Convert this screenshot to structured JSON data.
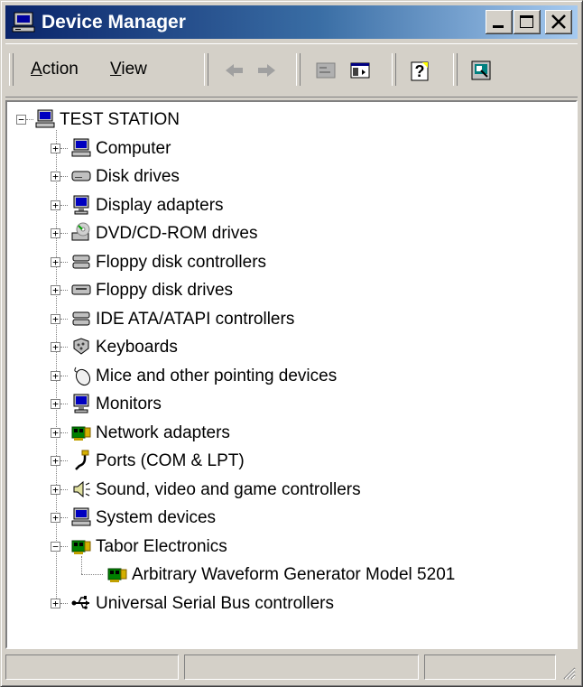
{
  "window": {
    "title": "Device Manager",
    "minimize_label": "_",
    "maximize_label": "□",
    "close_label": "×"
  },
  "toolbar": {
    "action": {
      "accel": "A",
      "rest": "ction"
    },
    "view": {
      "accel": "V",
      "rest": "iew"
    },
    "buttons": [
      "back-arrow-icon",
      "forward-arrow-icon",
      "properties-icon",
      "show-hide-console-tree-icon",
      "help-icon",
      "scan-hardware-icon"
    ]
  },
  "tree": {
    "root": "TEST STATION",
    "items": [
      {
        "label": "Computer",
        "icon": "computer-icon",
        "expanded": false
      },
      {
        "label": "Disk drives",
        "icon": "disk-drive-icon",
        "expanded": false
      },
      {
        "label": "Display adapters",
        "icon": "display-adapter-icon",
        "expanded": false
      },
      {
        "label": "DVD/CD-ROM drives",
        "icon": "cdrom-icon",
        "expanded": false
      },
      {
        "label": "Floppy disk controllers",
        "icon": "controller-icon",
        "expanded": false
      },
      {
        "label": "Floppy disk drives",
        "icon": "floppy-drive-icon",
        "expanded": false
      },
      {
        "label": "IDE ATA/ATAPI controllers",
        "icon": "controller-icon",
        "expanded": false
      },
      {
        "label": "Keyboards",
        "icon": "keyboard-icon",
        "expanded": false
      },
      {
        "label": "Mice and other pointing devices",
        "icon": "mouse-icon",
        "expanded": false
      },
      {
        "label": "Monitors",
        "icon": "monitor-icon",
        "expanded": false
      },
      {
        "label": "Network adapters",
        "icon": "network-card-icon",
        "expanded": false
      },
      {
        "label": "Ports (COM & LPT)",
        "icon": "port-icon",
        "expanded": false
      },
      {
        "label": "Sound, video and game controllers",
        "icon": "speaker-icon",
        "expanded": false
      },
      {
        "label": "System devices",
        "icon": "computer-icon",
        "expanded": false
      },
      {
        "label": "Tabor Electronics",
        "icon": "network-card-icon",
        "expanded": true
      },
      {
        "label": "Universal Serial Bus controllers",
        "icon": "usb-icon",
        "expanded": false
      }
    ],
    "child": {
      "parent": "Tabor Electronics",
      "label": "Arbitrary Waveform Generator Model 5201",
      "icon": "network-card-icon"
    }
  },
  "colors": {
    "face": "#d4d0c8",
    "title_start": "#0a246a",
    "title_end": "#a6caf0"
  }
}
